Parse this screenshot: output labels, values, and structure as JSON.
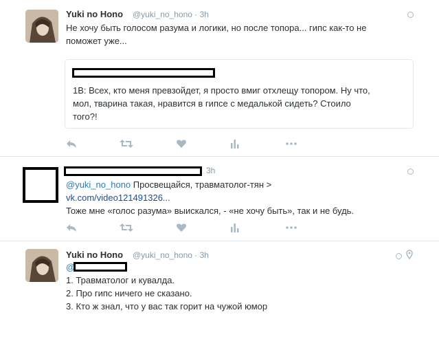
{
  "tweets": [
    {
      "name": "Yuki no Hono",
      "handle": "@yuki_no_hono",
      "time": "3h",
      "text_lines": [
        "Не хочу быть голосом разума и логики, но после топора... гипс как-то не",
        "поможет уже..."
      ],
      "quote": {
        "text_lines": [
          "1В: Всех, кто меня превзойдет, я просто вмиг отхлещу топором. Ну что,",
          "мол, тварина такая, нравится в гипсе с медалькой сидеть? Стоило",
          "того?!"
        ]
      }
    },
    {
      "time": "3h",
      "mention": "@yuki_no_hono",
      "line1_rest": " Просвещайся, травматолог-тян >",
      "link": "vk.com/video121491326...",
      "line3": "Тоже мне «голос разума» выискался, - «не хочу быть», так и не будь."
    },
    {
      "name": "Yuki no Hono",
      "handle": "@yuki_no_hono",
      "time": "3h",
      "mention_prefix": "@",
      "lines": [
        "1. Травматолог и кувалда.",
        "2. Про гипс ничего не сказано.",
        "3. Кто ж знал, что у вас так горит на чужой юмор"
      ]
    }
  ],
  "actions": [
    "reply-icon",
    "retweet-icon",
    "favorite-icon",
    "analytics-icon",
    "more-icon"
  ],
  "colors": {
    "icon": "#aab8c2",
    "link": "#1b4e8f",
    "mention": "#2b7bb9"
  }
}
